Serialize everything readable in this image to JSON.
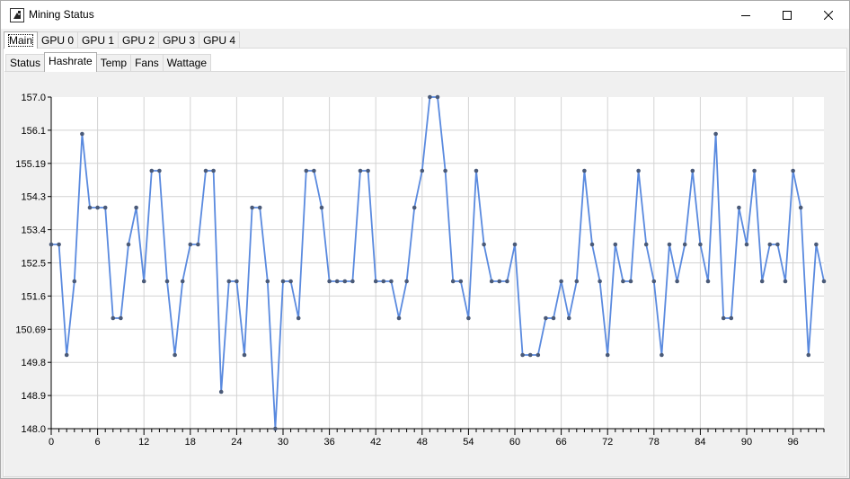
{
  "window": {
    "title": "Mining Status",
    "icon": "app-icon",
    "controls": [
      "minimize-icon",
      "maximize-icon",
      "close-icon"
    ]
  },
  "device_tabs": [
    {
      "label": "Main",
      "selected": true
    },
    {
      "label": "GPU 0",
      "selected": false
    },
    {
      "label": "GPU 1",
      "selected": false
    },
    {
      "label": "GPU 2",
      "selected": false
    },
    {
      "label": "GPU 3",
      "selected": false
    },
    {
      "label": "GPU 4",
      "selected": false
    }
  ],
  "metric_tabs": [
    {
      "label": "Status",
      "selected": false
    },
    {
      "label": "Hashrate",
      "selected": true
    },
    {
      "label": "Temp",
      "selected": false
    },
    {
      "label": "Fans",
      "selected": false
    },
    {
      "label": "Wattage",
      "selected": false
    }
  ],
  "chart_data": {
    "type": "line",
    "title": "",
    "xlabel": "",
    "ylabel": "",
    "xlim": [
      0,
      100
    ],
    "ylim": [
      148.0,
      157.0
    ],
    "x_ticks": [
      "0",
      "6",
      "12",
      "18",
      "24",
      "30",
      "36",
      "42",
      "48",
      "54",
      "60",
      "66",
      "72",
      "78",
      "84",
      "90",
      "96"
    ],
    "y_ticks": [
      "148.0",
      "148.9",
      "149.8",
      "150.69",
      "151.6",
      "152.5",
      "153.4",
      "154.3",
      "155.19",
      "156.1",
      "157.0"
    ],
    "grid": true,
    "line_color": "#5a8adf",
    "marker_color": "#4a5a78",
    "series": [
      {
        "values": [
          153.0,
          153.0,
          150.0,
          152.0,
          156.0,
          154.0,
          154.0,
          154.0,
          151.0,
          151.0,
          153.0,
          154.0,
          152.0,
          155.0,
          155.0,
          152.0,
          150.0,
          152.0,
          153.0,
          153.0,
          155.0,
          155.0,
          149.0,
          152.0,
          152.0,
          150.0,
          154.0,
          154.0,
          152.0,
          148.0,
          152.0,
          152.0,
          151.0,
          155.0,
          155.0,
          154.0,
          152.0,
          152.0,
          152.0,
          152.0,
          155.0,
          155.0,
          152.0,
          152.0,
          152.0,
          151.0,
          152.0,
          154.0,
          155.0,
          157.0,
          157.0,
          155.0,
          152.0,
          152.0,
          151.0,
          155.0,
          153.0,
          152.0,
          152.0,
          152.0,
          153.0,
          150.0,
          150.0,
          150.0,
          151.0,
          151.0,
          152.0,
          151.0,
          152.0,
          155.0,
          153.0,
          152.0,
          150.0,
          153.0,
          152.0,
          152.0,
          155.0,
          153.0,
          152.0,
          150.0,
          153.0,
          152.0,
          153.0,
          155.0,
          153.0,
          152.0,
          156.0,
          151.0,
          151.0,
          154.0,
          153.0,
          155.0,
          152.0,
          153.0,
          153.0,
          152.0,
          155.0,
          154.0,
          150.0,
          153.0,
          152.0
        ]
      }
    ]
  }
}
